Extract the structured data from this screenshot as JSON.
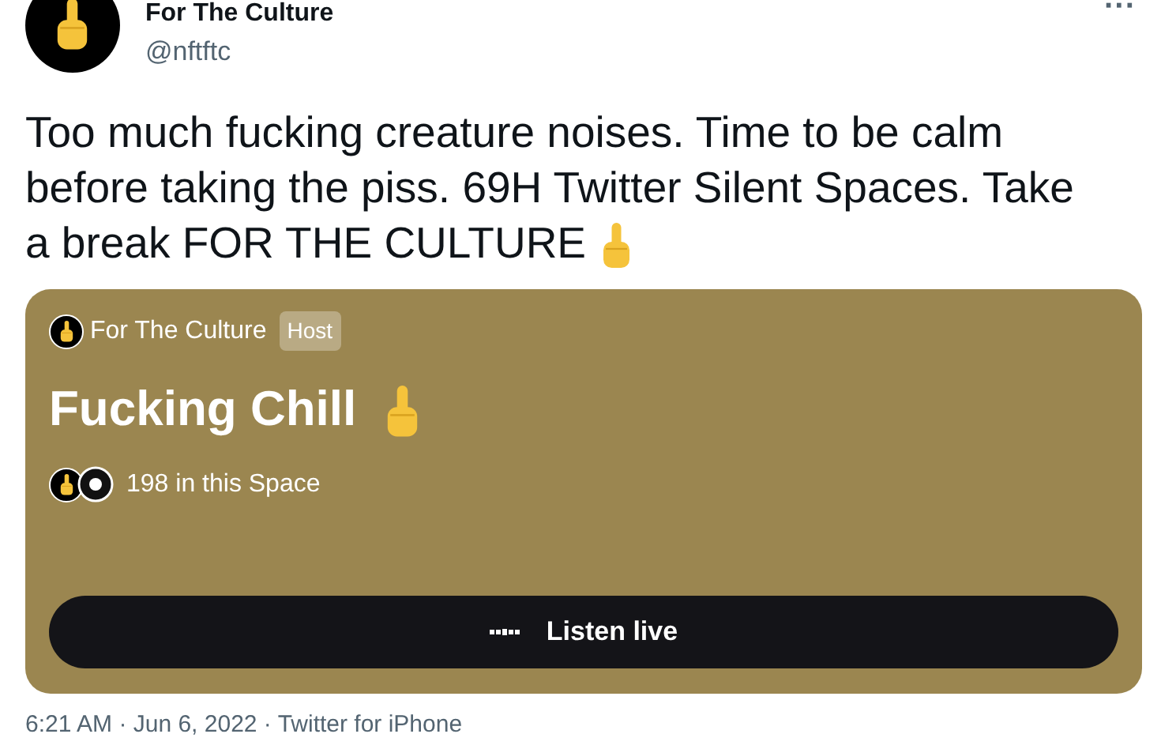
{
  "author": {
    "name": "For The Culture",
    "handle": "@nftftc"
  },
  "more": "···",
  "tweet_lines": [
    "Too much fucking creature noises. Time to be calm",
    "before taking the piss. 69H Twitter Silent Spaces. Take",
    "a break FOR THE CULTURE"
  ],
  "space_card": {
    "host_name": "For The Culture",
    "host_badge": "Host",
    "title": "Fucking Chill",
    "listeners": "198 in this Space",
    "button": "Listen live"
  },
  "footer": "6:21 AM · Jun 6, 2022 · Twitter for iPhone"
}
